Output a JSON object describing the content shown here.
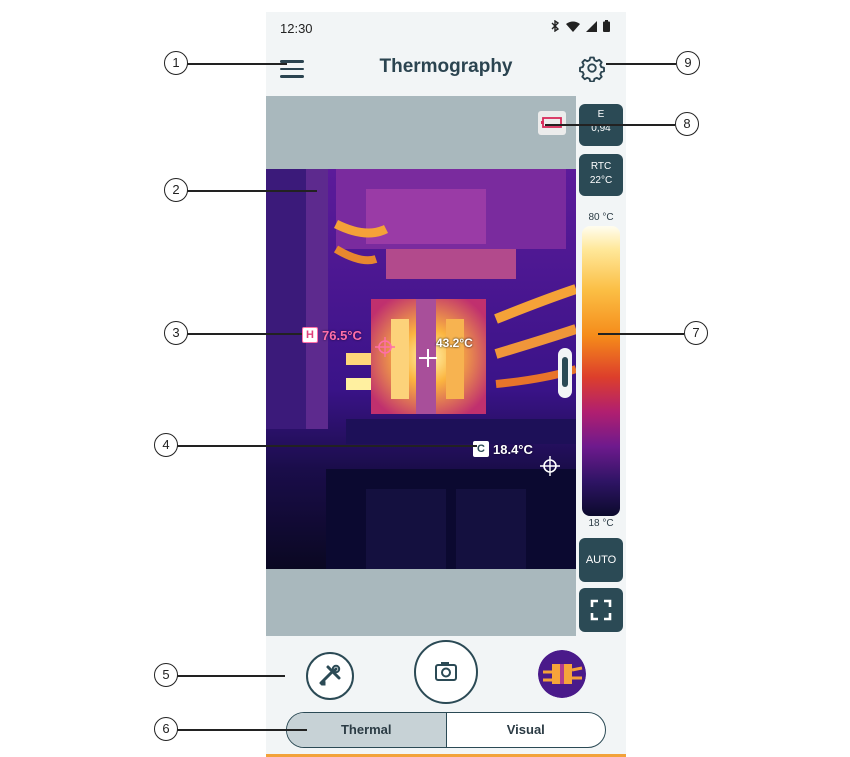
{
  "status_bar": {
    "time": "12:30"
  },
  "app_bar": {
    "title": "Thermography"
  },
  "emissivity": {
    "label": "E",
    "value": "0,94"
  },
  "rtc": {
    "label": "RTC",
    "value": "22°C"
  },
  "scale": {
    "max": "80 °C",
    "min": "18 °C",
    "auto_label": "AUTO"
  },
  "measurements": {
    "hot": {
      "tag": "H",
      "value": "76.5°C",
      "color": "#ff6fa8"
    },
    "center": {
      "value": "43.2°C"
    },
    "cold": {
      "tag": "C",
      "value": "18.4°C",
      "color": "#ffffff"
    }
  },
  "mode_toggle": {
    "options": [
      "Thermal",
      "Visual"
    ],
    "selected": "Thermal"
  },
  "callouts": [
    "1",
    "2",
    "3",
    "4",
    "5",
    "6",
    "7",
    "8",
    "9"
  ],
  "colors": {
    "primary": "#2b4a55",
    "background": "#f2f5f6",
    "accent": "#f2a23a",
    "viewer_bg": "#a9b8bd"
  }
}
